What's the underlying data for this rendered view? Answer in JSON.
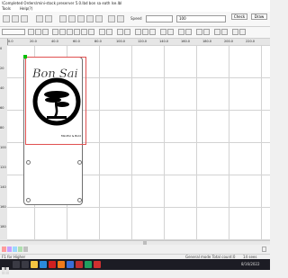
{
  "window": {
    "title": "\\Completed Orders\\mini-stock preserver 5.0.lbd bon sa eath lse.lbl"
  },
  "menu": {
    "items": [
      "Tools",
      "Help(?)"
    ]
  },
  "toolbar": {
    "speed_label": "Speed",
    "zoom_value": "100",
    "check_label": "Check",
    "draw_label": "Draw"
  },
  "ruler": {
    "top": [
      "0.0",
      "20.0",
      "40.0",
      "60.0",
      "80.0",
      "100.0",
      "120.0",
      "140.0",
      "160.0",
      "180.0",
      "200.0",
      "220.0"
    ],
    "left": [
      "0",
      "20",
      "40",
      "60",
      "80",
      "100",
      "120",
      "140",
      "160",
      "180"
    ]
  },
  "design": {
    "logo_text": "Bon Sai",
    "logo_subtext": "Mindful & Bold"
  },
  "palette": {
    "colors": [
      "#ff9c9c",
      "#c8a0ff",
      "#9cd8ff",
      "#b0e0b0",
      "#c0c0c0",
      "#f0f0f0"
    ]
  },
  "status": {
    "left": "F1 for Higher",
    "right": "General mode Total count:0",
    "extra": "14 sees"
  },
  "taskbar": {
    "apps": [
      {
        "icon": "search-icon",
        "color": "#3a3a44"
      },
      {
        "icon": "taskview-icon",
        "color": "#3a3a44"
      },
      {
        "icon": "explorer-icon",
        "color": "#f4c542"
      },
      {
        "icon": "edge-icon",
        "color": "#2a8bdc"
      },
      {
        "icon": "adobe-icon",
        "color": "#d02020"
      },
      {
        "icon": "ai-icon",
        "color": "#f07a1a"
      },
      {
        "icon": "app-icon",
        "color": "#3a6ed8"
      },
      {
        "icon": "laser-icon",
        "color": "#c03030"
      },
      {
        "icon": "chrome-icon",
        "color": "#20a060"
      },
      {
        "icon": "adobe2-icon",
        "color": "#d03030"
      }
    ],
    "clock": "8/16/2022"
  }
}
